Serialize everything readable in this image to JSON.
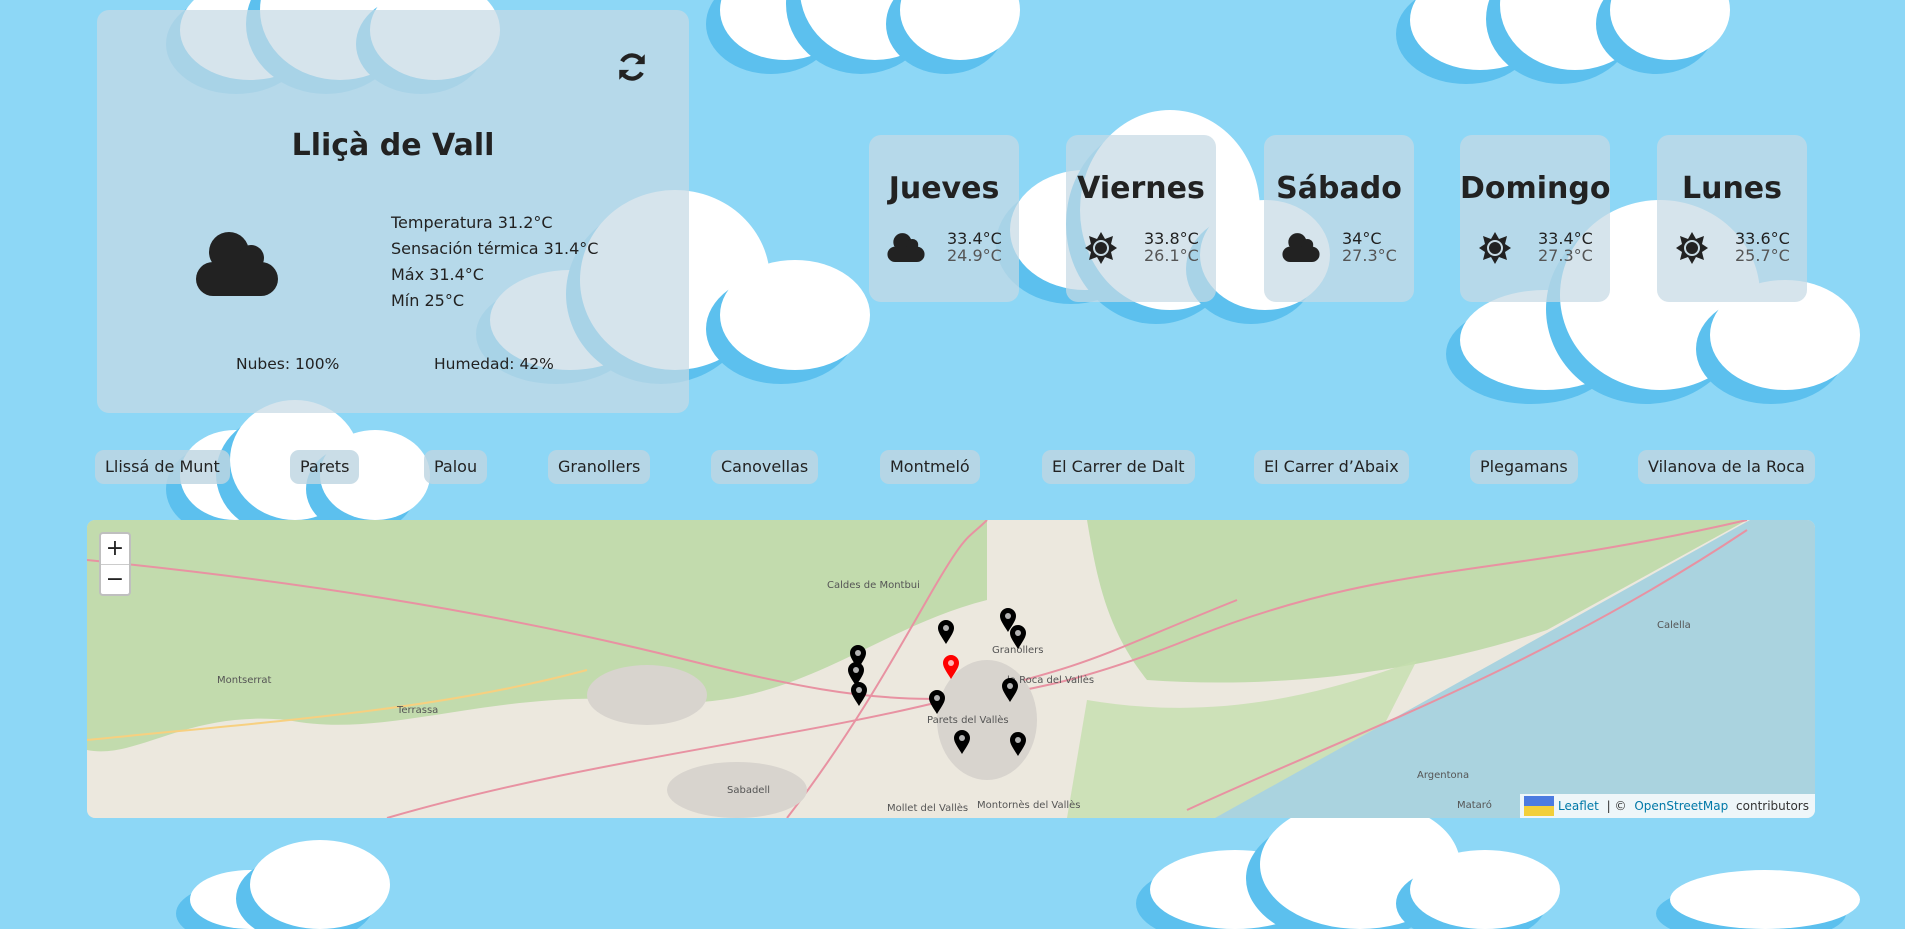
{
  "current": {
    "city": "Lliçà de Vall",
    "icon": "cloud-icon",
    "temperature": "Temperatura 31.2°C",
    "feels_like": "Sensación térmica 31.4°C",
    "max": "Máx 31.4°C",
    "min": "Mín 25°C",
    "clouds": "Nubes: 100%",
    "humidity": "Humedad: 42%"
  },
  "forecast": [
    {
      "day": "Jueves",
      "icon": "cloud-icon",
      "max": "33.4°C",
      "min": "24.9°C"
    },
    {
      "day": "Viernes",
      "icon": "sun-icon",
      "max": "33.8°C",
      "min": "26.1°C"
    },
    {
      "day": "Sábado",
      "icon": "cloud-icon",
      "max": "34°C",
      "min": "27.3°C"
    },
    {
      "day": "Domingo",
      "icon": "sun-icon",
      "max": "33.4°C",
      "min": "27.3°C"
    },
    {
      "day": "Lunes",
      "icon": "sun-icon",
      "max": "33.6°C",
      "min": "25.7°C"
    }
  ],
  "towns": [
    "Llissá de Munt",
    "Parets",
    "Palou",
    "Granollers",
    "Canovellas",
    "Montmeló",
    "El Carrer de Dalt",
    "El Carrer d’Abaix",
    "Plegamans",
    "Vilanova de la Roca"
  ],
  "map": {
    "zoom_in": "+",
    "zoom_out": "−",
    "attribution": {
      "leaflet": "Leaflet",
      "sep": " | © ",
      "osm": "OpenStreetMap",
      "suffix": " contributors"
    },
    "labels": [
      "Caldes de Montbui",
      "Terrassa",
      "Sabadell",
      "Mollet del Vallès",
      "Montornès del Vallès",
      "Granollers",
      "la Roca del Vallès",
      "Mataró",
      "Argentona",
      "Calella",
      "Montserrat",
      "Parets del Vallès"
    ],
    "marker_color_selected": "#ff0000",
    "marker_color": "#000000"
  }
}
